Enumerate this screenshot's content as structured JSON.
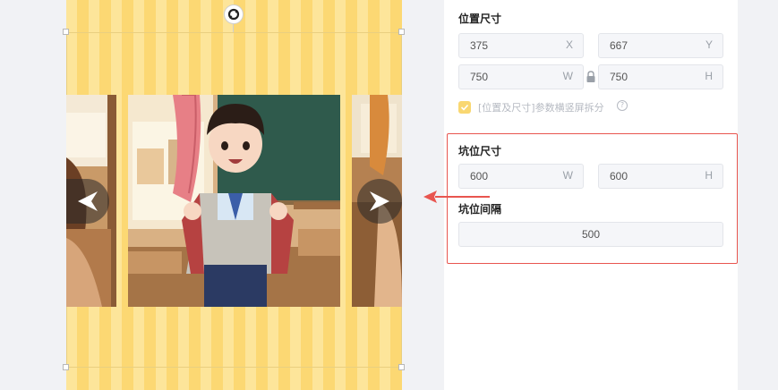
{
  "position_size": {
    "title": "位置尺寸",
    "x": {
      "value": "375",
      "unit": "X"
    },
    "y": {
      "value": "667",
      "unit": "Y"
    },
    "w": {
      "value": "750",
      "unit": "W"
    },
    "h": {
      "value": "750",
      "unit": "H"
    },
    "split_checkbox_label": "[位置及尺寸]参数横竖屏拆分",
    "help_glyph": "?"
  },
  "slot_size": {
    "title": "坑位尺寸",
    "w": {
      "value": "600",
      "unit": "W"
    },
    "h": {
      "value": "600",
      "unit": "H"
    }
  },
  "slot_spacing": {
    "title": "坑位间隔",
    "value": "500"
  },
  "colors": {
    "accent_yellow": "#f9d771",
    "highlight_red": "#e8554f",
    "stripe_light": "#fde59a",
    "stripe_dark": "#fcd873"
  },
  "icons": [
    "rotate-icon",
    "lock-icon",
    "help-icon",
    "check-icon",
    "arrow-left-icon",
    "arrow-right-icon"
  ]
}
